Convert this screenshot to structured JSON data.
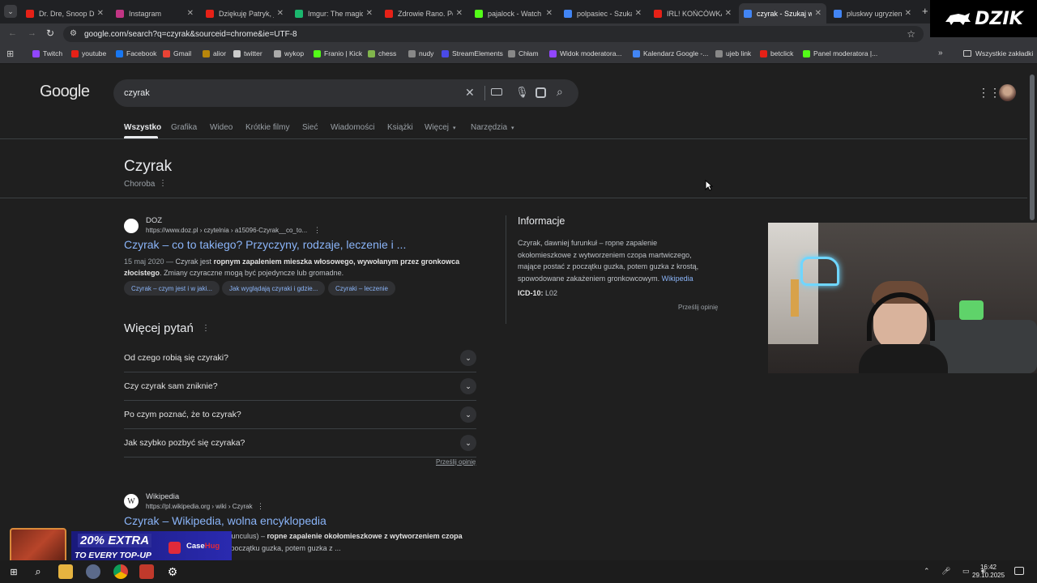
{
  "tabs": [
    {
      "title": "Dr. Dre, Snoop Do",
      "color": "#e62117"
    },
    {
      "title": "Instagram",
      "color": "#c13584"
    },
    {
      "title": "Dziękuję Patryk, je",
      "color": "#e62117"
    },
    {
      "title": "Imgur: The magic",
      "color": "#1bb76e"
    },
    {
      "title": "Zdrowie Rano. Pó",
      "color": "#e62117"
    },
    {
      "title": "pajalock - Watch",
      "color": "#53fc18"
    },
    {
      "title": "polpasiec - Szukaj",
      "color": "#4285f4"
    },
    {
      "title": "IRL! KOŃCÓWKA",
      "color": "#e62117"
    },
    {
      "title": "czyrak - Szukaj w",
      "color": "#4285f4"
    },
    {
      "title": "pluskwy ugryzienie",
      "color": "#4285f4"
    }
  ],
  "url": "google.com/search?q=czyrak&sourceid=chrome&ie=UTF-8",
  "bookmarks": [
    {
      "label": "Twitch",
      "color": "#9146ff"
    },
    {
      "label": "youtube",
      "color": "#e62117"
    },
    {
      "label": "Facebook",
      "color": "#1877f2"
    },
    {
      "label": "Gmail",
      "color": "#ea4335"
    },
    {
      "label": "alior",
      "color": "#b8860b"
    },
    {
      "label": "twitter",
      "color": "#cccccc"
    },
    {
      "label": "wykop",
      "color": "#aaaaaa"
    },
    {
      "label": "Franio | Kick",
      "color": "#53fc18"
    },
    {
      "label": "chess",
      "color": "#81b64c"
    },
    {
      "label": "nudy",
      "color": "#888888"
    },
    {
      "label": "StreamElements",
      "color": "#4a4ae8"
    },
    {
      "label": "Chłam",
      "color": "#888888"
    },
    {
      "label": "Widok moderatora...",
      "color": "#9146ff"
    },
    {
      "label": "Kalendarz Google -...",
      "color": "#4285f4"
    },
    {
      "label": "ujeb link",
      "color": "#888888"
    },
    {
      "label": "betclick",
      "color": "#e62117"
    },
    {
      "label": "Panel moderatora |...",
      "color": "#53fc18"
    }
  ],
  "all_bookmarks": "Wszystkie zakładki",
  "search": {
    "logo": "Google",
    "query": "czyrak"
  },
  "search_tabs": [
    "Wszystko",
    "Grafika",
    "Wideo",
    "Krótkie filmy",
    "Sieć",
    "Wiadomości",
    "Książki",
    "Więcej",
    "Narzędzia"
  ],
  "entity": {
    "title": "Czyrak",
    "subtitle": "Choroba"
  },
  "result1": {
    "source": "DOZ",
    "url": "https://www.doz.pl › czytelnia › a15096-Czyrak__co_to...",
    "title": "Czyrak – co to takiego? Przyczyny, rodzaje, leczenie i ...",
    "date": "15 maj 2020 —",
    "snippet_a": " Czyrak jest ",
    "snippet_bold": "ropnym zapaleniem mieszka włosowego, wywołanym przez gronkowca złocistego",
    "snippet_b": ". Zmiany czyraczne mogą być pojedyncze lub gromadne.",
    "chips": [
      "Czyrak – czym jest i w jaki...",
      "Jak wyglądają czyraki i gdzie...",
      "Czyraki – leczenie"
    ]
  },
  "paa": {
    "title": "Więcej pytań",
    "questions": [
      "Od czego robią się czyraki?",
      "Czy czyrak sam zniknie?",
      "Po czym poznać, że to czyrak?",
      "Jak szybko pozbyć się czyraka?"
    ],
    "feedback": "Prześlij opinię"
  },
  "result2": {
    "source": "Wikipedia",
    "url": "https://pl.wikipedia.org › wiki › Czyrak",
    "title": "Czyrak – Wikipedia, wolna encyklopedia",
    "snippet_a": "furunculus) – ",
    "snippet_bold": "ropne zapalenie okołomieszkowe z wytworzeniem czopa",
    "snippet_b": " z początku guzka, potem guzka z ..."
  },
  "info": {
    "title": "Informacje",
    "text": "Czyrak, dawniej furunkuł – ropne zapalenie okołomieszkowe z wytworzeniem czopa martwiczego, mające postać z początku guzka, potem guzka z krostą, spowodowane zakażeniem gronkowcowym.",
    "source": "Wikipedia",
    "icd_label": "ICD-10:",
    "icd_value": "L02",
    "feedback": "Prześlij opinię"
  },
  "overlay": {
    "dzik": "DZIK",
    "ad_line1": "20% EXTRA",
    "ad_line2": "TO EVERY TOP-UP",
    "ad_brand_a": "Case",
    "ad_brand_b": "Hug"
  },
  "clock": {
    "time": "16:42",
    "date": "29.10.2025"
  }
}
